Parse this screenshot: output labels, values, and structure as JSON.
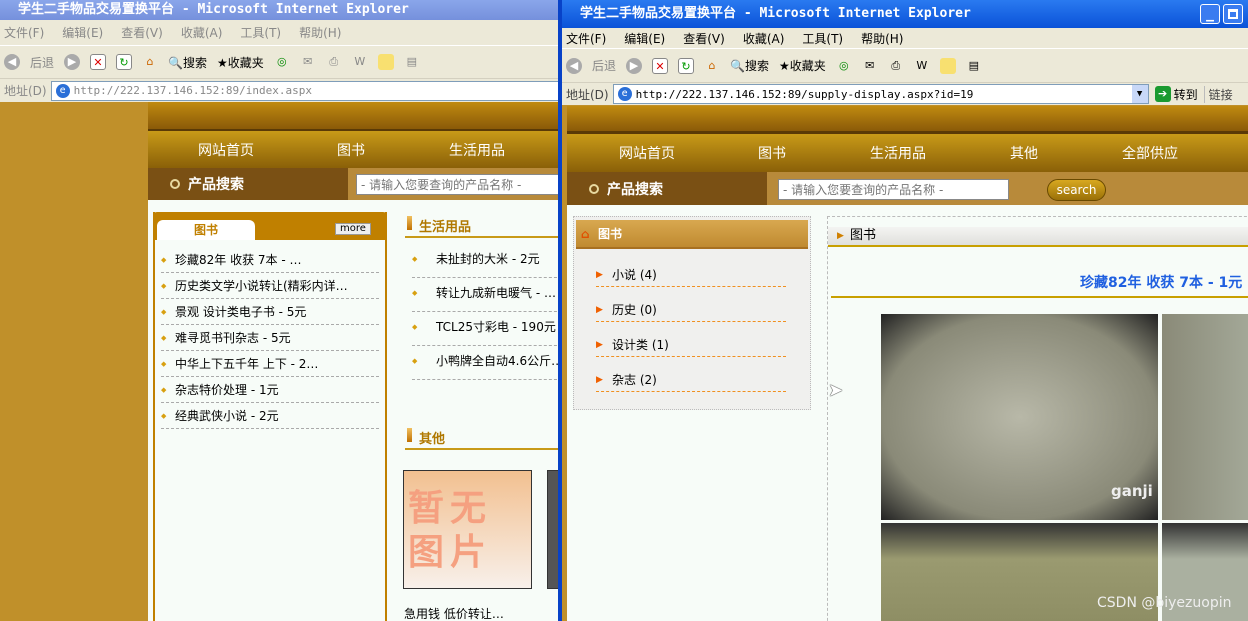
{
  "back": {
    "title": "学生二手物品交易置换平台 - Microsoft Internet Explorer",
    "menu": [
      "文件(F)",
      "编辑(E)",
      "查看(V)",
      "收藏(A)",
      "工具(T)",
      "帮助(H)"
    ],
    "toolbar": {
      "back": "后退",
      "search": "搜索",
      "favorites": "收藏夹"
    },
    "address_label": "地址(D)",
    "url": "http://222.137.146.152:89/index.aspx",
    "nav": [
      "网站首页",
      "图书",
      "生活用品"
    ],
    "search_label": "产品搜索",
    "search_placeholder": "- 请输入您要查询的产品名称 -",
    "books": {
      "tab": "图书",
      "more": "more",
      "items": [
        "珍藏82年 收获 7本 - …",
        "历史类文学小说转让(精彩内详…",
        "景观 设计类电子书 - 5元",
        "难寻觅书刊杂志 - 5元",
        "中华上下五千年 上下 - 2…",
        "杂志特价处理 - 1元",
        "经典武侠小说 - 2元"
      ]
    },
    "living": {
      "title": "生活用品",
      "items": [
        "未扯封的大米 - 2元",
        "转让九成新电暖气 - …",
        "TCL25寸彩电 - 190元",
        "小鸭牌全自动4.6公斤…"
      ]
    },
    "other": {
      "title": "其他",
      "no_image": "暂无图片",
      "caption": "急用钱 低价转让…"
    }
  },
  "front": {
    "title": "学生二手物品交易置换平台 - Microsoft Internet Explorer",
    "menu": [
      "文件(F)",
      "编辑(E)",
      "查看(V)",
      "收藏(A)",
      "工具(T)",
      "帮助(H)"
    ],
    "toolbar": {
      "back": "后退",
      "search": "搜索",
      "favorites": "收藏夹"
    },
    "address_label": "地址(D)",
    "url": "http://222.137.146.152:89/supply-display.aspx?id=19",
    "go": "转到",
    "links": "链接",
    "nav": [
      "网站首页",
      "图书",
      "生活用品",
      "其他",
      "全部供应"
    ],
    "search_label": "产品搜索",
    "search_placeholder": "- 请输入您要查询的产品名称 -",
    "search_button": "search",
    "sidebar": {
      "title": "图书",
      "categories": [
        "小说 (4)",
        "历史 (0)",
        "设计类 (1)",
        "杂志 (2)"
      ]
    },
    "panel": {
      "title": "图书",
      "product_title": "珍藏82年 收获 7本 - 1元"
    }
  },
  "watermark": "CSDN @biyezuopin",
  "colors": {
    "gold": "#c0902a",
    "title_active": "#0a5fd8",
    "title_inactive": "#7a96df",
    "product_title": "#2060e0"
  }
}
